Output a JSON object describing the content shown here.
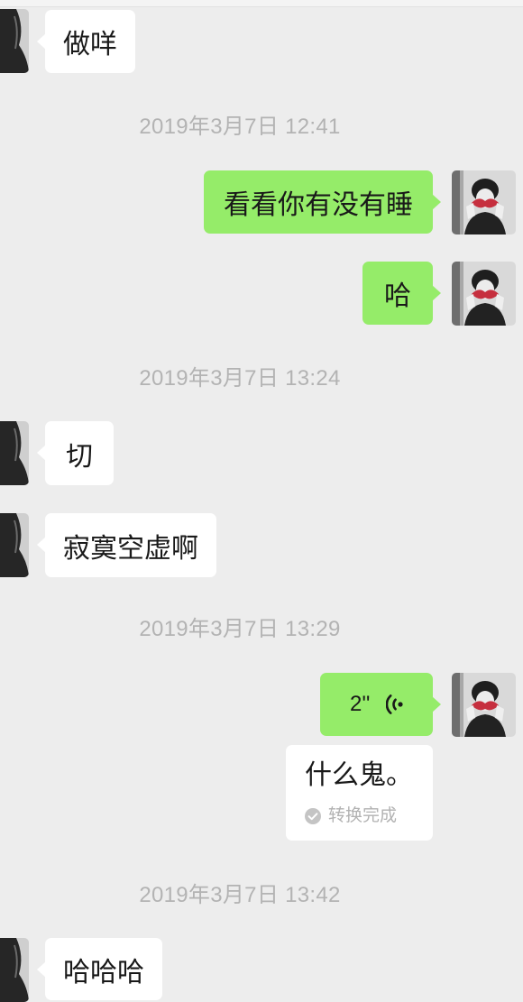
{
  "colors": {
    "background": "#ededed",
    "bubble_sent": "#95ec69",
    "bubble_received": "#ffffff",
    "timestamp": "#b3b3b3",
    "text": "#191919",
    "transcription_status": "#b2b2b2"
  },
  "messages": [
    {
      "received": "做咩"
    },
    {
      "timestamp": "2019年3月7日 12:41"
    },
    {
      "sent": "看看你有没有睡"
    },
    {
      "sent": "哈"
    },
    {
      "timestamp": "2019年3月7日 13:24"
    },
    {
      "received": "切"
    },
    {
      "received": "寂寞空虚啊"
    },
    {
      "timestamp": "2019年3月7日 13:29"
    },
    {
      "sent_voice": {
        "duration": "2''",
        "icon": "voice-wave-icon",
        "transcription": "什么鬼。",
        "transcription_status": "转换完成",
        "status_icon": "check-circle-icon"
      }
    },
    {
      "timestamp": "2019年3月7日 13:42"
    },
    {
      "received": "哈哈哈"
    }
  ]
}
